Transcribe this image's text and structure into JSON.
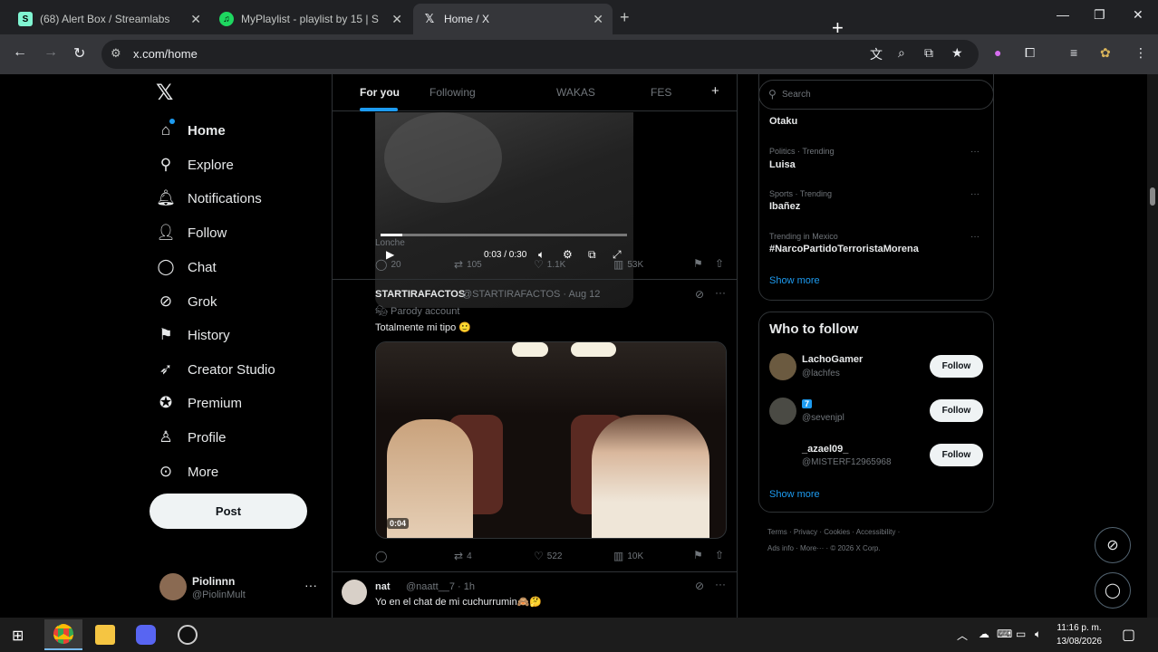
{
  "browser": {
    "tabs": [
      {
        "title": "(68) Alert Box / Streamlabs",
        "favicon_color": "#80f5d2",
        "favicon_glyph": "S"
      },
      {
        "title": "MyPlaylist - playlist by 15 | Spotify",
        "favicon_color": "#1ed760",
        "favicon_glyph": "♫"
      },
      {
        "title": "Home / X",
        "favicon_color": "#000000",
        "favicon_glyph": "X"
      }
    ],
    "url": "x.com/home",
    "window_controls": [
      "—",
      "❐",
      "✕"
    ]
  },
  "sidebar": {
    "items": [
      {
        "label": "Home",
        "icon": "home-icon"
      },
      {
        "label": "Explore",
        "icon": "search-icon"
      },
      {
        "label": "Notifications",
        "icon": "bell-icon"
      },
      {
        "label": "Follow",
        "icon": "person-add-icon"
      },
      {
        "label": "Chat",
        "icon": "chat-icon"
      },
      {
        "label": "Grok",
        "icon": "grok-icon"
      },
      {
        "label": "History",
        "icon": "bookmark-icon"
      },
      {
        "label": "Creator Studio",
        "icon": "rocket-icon"
      },
      {
        "label": "Premium",
        "icon": "verified-icon"
      },
      {
        "label": "Profile",
        "icon": "person-icon"
      },
      {
        "label": "More",
        "icon": "more-circle-icon"
      }
    ],
    "post_label": "Post",
    "account": {
      "name": "Piolinnn",
      "handle": "@PiolinMult"
    }
  },
  "timeline": {
    "tabs": [
      "For you",
      "Following",
      "WAKAS",
      "FES"
    ],
    "tweet1": {
      "video_time": "0:03 / 0:30",
      "caption": "Lonche",
      "stats": {
        "replies": "20",
        "reposts": "105",
        "likes": "1.1K",
        "views": "53K"
      }
    },
    "tweet2": {
      "name": "STARTIRAFACTOS",
      "handle_time": "@STARTIRAFACTOS · Aug 12",
      "label": "Parody account",
      "text": "Totalmente mi tipo 🙂",
      "video_time": "0:04",
      "stats": {
        "replies": "",
        "reposts": "4",
        "likes": "522",
        "views": "10K"
      }
    },
    "tweet3": {
      "name": "nat",
      "handle_time": "@naatt__7 · 1h",
      "text": "Yo en el chat de mi cuchurrumin🙈🤔"
    }
  },
  "right": {
    "search_placeholder": "Search",
    "trends": [
      {
        "meta": "",
        "title": "Otaku"
      },
      {
        "meta": "Politics · Trending",
        "title": "Luisa"
      },
      {
        "meta": "Sports · Trending",
        "title": "Ibañez"
      },
      {
        "meta": "Trending in Mexico",
        "title": "#NarcoPartidoTerroristaMorena"
      }
    ],
    "trends_show_more": "Show more",
    "who_to_follow_title": "Who to follow",
    "who_to_follow": [
      {
        "name": "LachoGamer",
        "handle": "@lachfes",
        "avatar_color": "#6b5a40"
      },
      {
        "name": "7",
        "handle": "@sevenjpl",
        "avatar_color": "#4a4a44"
      },
      {
        "name": "_azael09_",
        "handle": "@MISTERF12965968",
        "avatar_color": "#000000"
      }
    ],
    "follow_label": "Follow",
    "wtf_show_more": "Show more",
    "footer_line1": "Terms · Privacy · Cookies · Accessibility ·",
    "footer_line2": "Ads info · More··· · © 2026 X Corp."
  },
  "taskbar": {
    "time": "11:16 p. m.",
    "date": "13/08/2026"
  }
}
